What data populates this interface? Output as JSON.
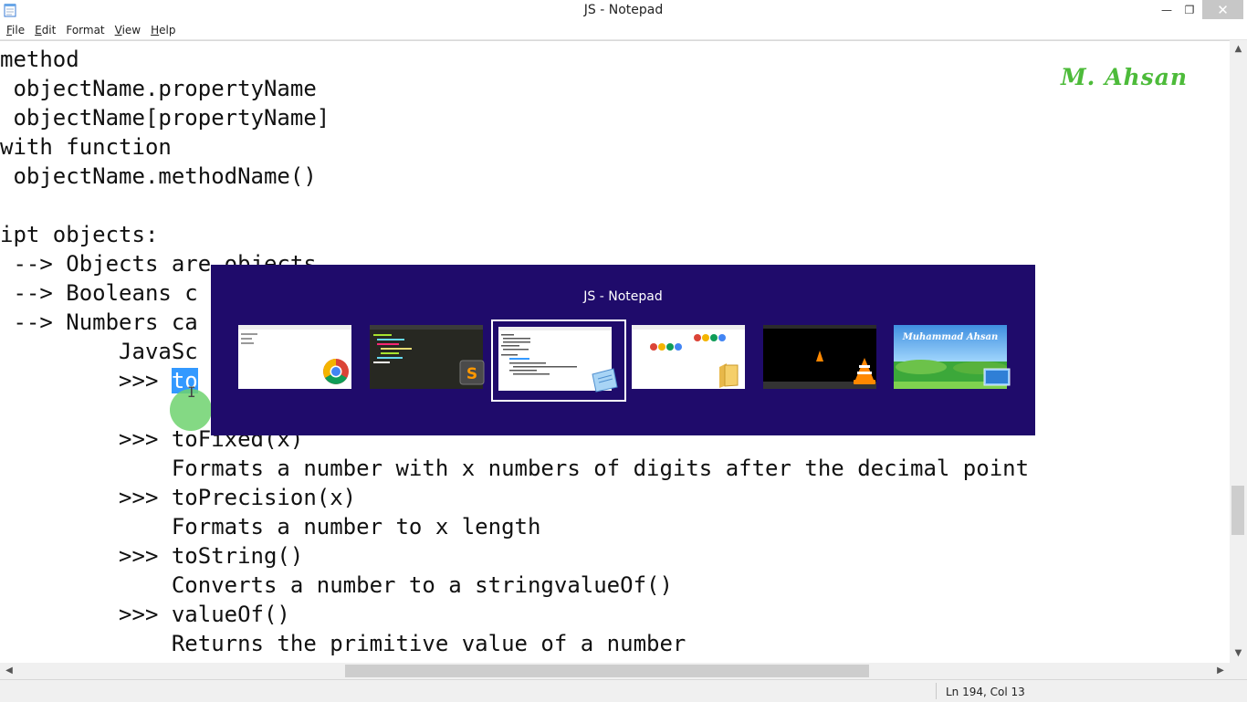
{
  "window": {
    "title": "JS - Notepad",
    "controls": {
      "minimize": "—",
      "maximize": "❐",
      "close": "✕"
    }
  },
  "menu": [
    {
      "acc": "F",
      "rest": "ile"
    },
    {
      "acc": "E",
      "rest": "dit"
    },
    {
      "acc": "",
      "rest": "Format"
    },
    {
      "acc": "V",
      "rest": "iew"
    },
    {
      "acc": "H",
      "rest": "elp"
    }
  ],
  "editor": {
    "lines": [
      "method",
      " objectName.propertyName",
      " objectName[propertyName]",
      "with function",
      " objectName.methodName()",
      "",
      "ipt objects:",
      " --> Objects are objects",
      " --> Booleans c",
      " --> Numbers ca",
      "         JavaSc",
      "         >>> ",
      "",
      "         >>> toFixed(x)",
      "             Formats a number with x numbers of digits after the decimal point",
      "         >>> toPrecision(x)",
      "             Formats a number to x length",
      "         >>> toString()",
      "             Converts a number to a stringvalueOf()",
      "         >>> valueOf()",
      "             Returns the primitive value of a number"
    ],
    "selected_text": "to",
    "cursor_glyph": "I"
  },
  "watermark": "M. Ahsan",
  "status": {
    "position": "Ln 194, Col 13"
  },
  "switcher": {
    "title": "JS - Notepad",
    "windows": [
      {
        "app": "Google Chrome",
        "badge_icon": "chrome-icon"
      },
      {
        "app": "Sublime Text",
        "badge_icon": "sublime-icon"
      },
      {
        "app": "Notepad",
        "badge_icon": "notepad-icon",
        "active": true
      },
      {
        "app": "File Explorer",
        "badge_icon": "folder-icon"
      },
      {
        "app": "VLC media player",
        "badge_icon": "vlc-icon"
      },
      {
        "app": "Desktop",
        "badge_icon": "desktop-icon",
        "preview_text": "Muhammad Ahsan"
      }
    ]
  },
  "colors": {
    "switcher_bg": "#1f0b6b",
    "selection": "#3399ff",
    "watermark": "#4dbb3a"
  }
}
